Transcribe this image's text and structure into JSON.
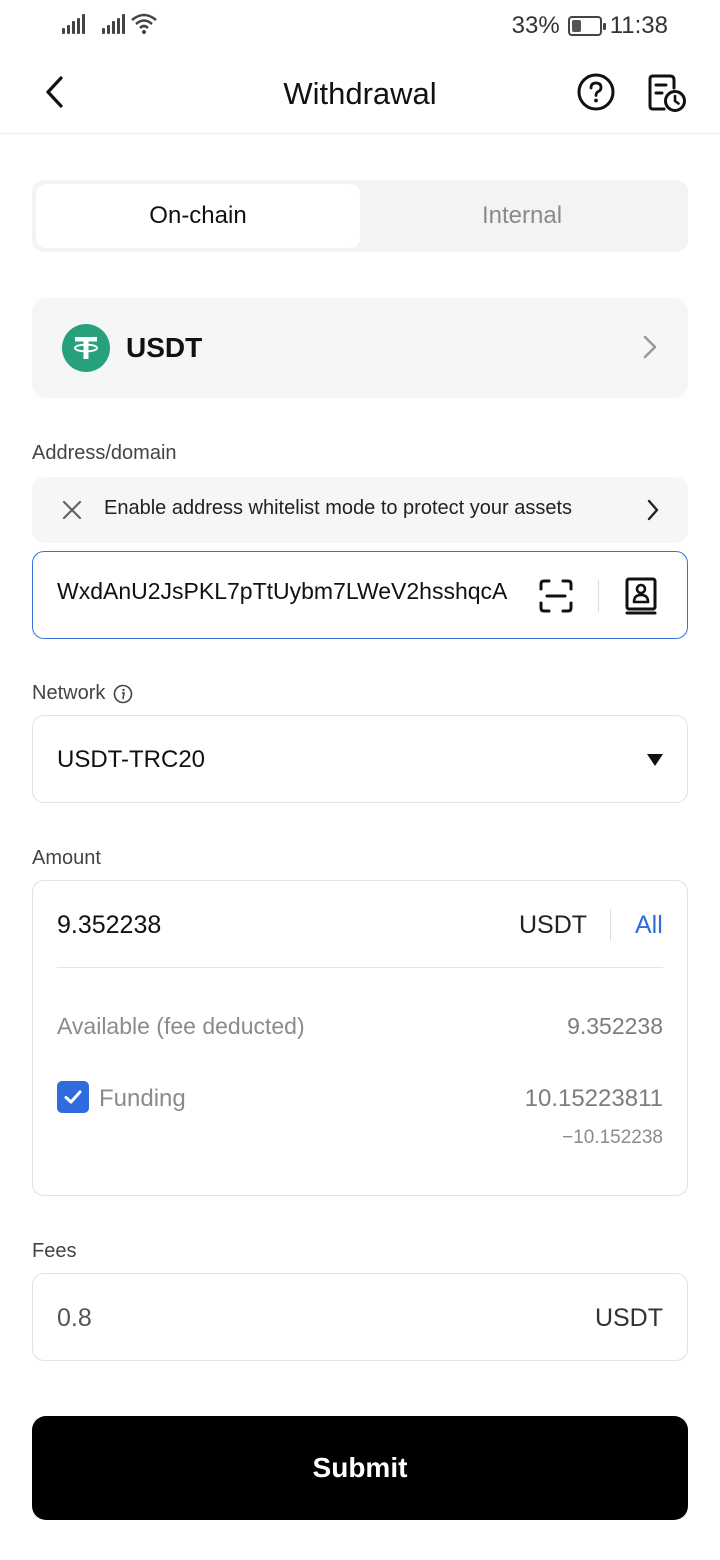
{
  "status_bar": {
    "battery_percent": "33%",
    "battery_level": 0.33,
    "time": "11:38"
  },
  "header": {
    "title": "Withdrawal",
    "icons": [
      "back-chevron-icon",
      "help-question-icon",
      "history-record-icon"
    ]
  },
  "tabs": [
    {
      "label": "On-chain",
      "active": true
    },
    {
      "label": "Internal",
      "active": false
    }
  ],
  "coin": {
    "symbol": "USDT",
    "logo_color": "#26a17b",
    "logo_icon": "tether-icon"
  },
  "address": {
    "label": "Address/domain",
    "notice_text": "Enable address whitelist mode to protect your assets",
    "value": "WxdAnU2JsPKL7pTtUybm7LWeV2hsshqcA",
    "focus_color": "#3473d9"
  },
  "network": {
    "label": "Network",
    "selected": "USDT-TRC20"
  },
  "amount": {
    "label": "Amount",
    "value": "9.352238",
    "unit": "USDT",
    "all_label": "All",
    "available_label": "Available (fee deducted)",
    "available_value": "9.352238",
    "funding_label": "Funding",
    "funding_checked": true,
    "funding_value": "10.15223811",
    "funding_deduction": "−10.152238"
  },
  "fees": {
    "label": "Fees",
    "value": "0.8",
    "unit": "USDT"
  },
  "submit_label": "Submit",
  "colors": {
    "accent_blue": "#2e6fd6",
    "checkbox_blue": "#2f6bdc",
    "submit_bg": "#000000"
  }
}
